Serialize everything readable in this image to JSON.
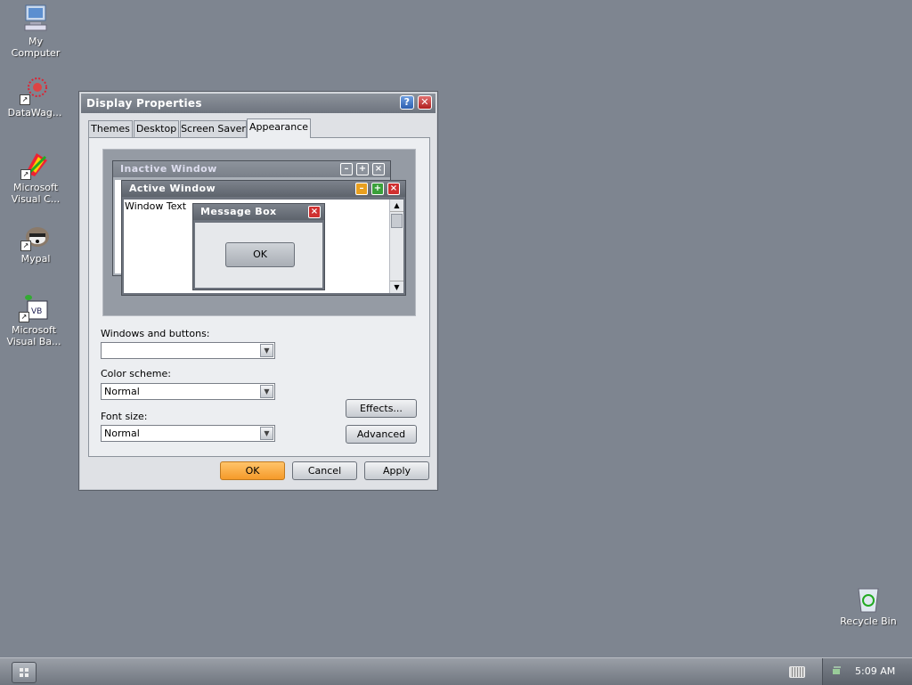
{
  "desktop": {
    "icons": [
      {
        "label_1": "My",
        "label_2": "Computer",
        "icon": "my-computer-icon"
      },
      {
        "label_1": "DataWag...",
        "icon": "datawag-icon"
      },
      {
        "label_1": "Microsoft",
        "label_2": "Visual C...",
        "icon": "visual-c-icon"
      },
      {
        "label_1": "Mypal",
        "icon": "mypal-icon"
      },
      {
        "label_1": "Microsoft",
        "label_2": "Visual Ba...",
        "icon": "visual-basic-icon"
      },
      {
        "label_1": "Recycle Bin",
        "icon": "recycle-bin-icon"
      }
    ]
  },
  "window": {
    "title": "Display Properties",
    "help_glyph": "?",
    "close_glyph": "✕",
    "tabs": [
      "Themes",
      "Desktop",
      "Screen Saver",
      "Appearance"
    ],
    "active_tab": "Appearance",
    "preview": {
      "inactive_title": "Inactive Window",
      "active_title": "Active Window",
      "window_text": "Window Text",
      "message_box_title": "Message Box",
      "ok_label": "OK"
    },
    "windows_and_buttons_label": "Windows and buttons:",
    "windows_and_buttons_value": "",
    "color_scheme_label": "Color scheme:",
    "color_scheme_value": "Normal",
    "font_size_label": "Font size:",
    "font_size_value": "Normal",
    "effects_label": "Effects...",
    "advanced_label": "Advanced",
    "ok_label": "OK",
    "cancel_label": "Cancel",
    "apply_label": "Apply"
  },
  "taskbar": {
    "clock": "5:09 AM"
  },
  "colors": {
    "desktop": "#7e8590",
    "ok_button": "#f59a2a"
  }
}
